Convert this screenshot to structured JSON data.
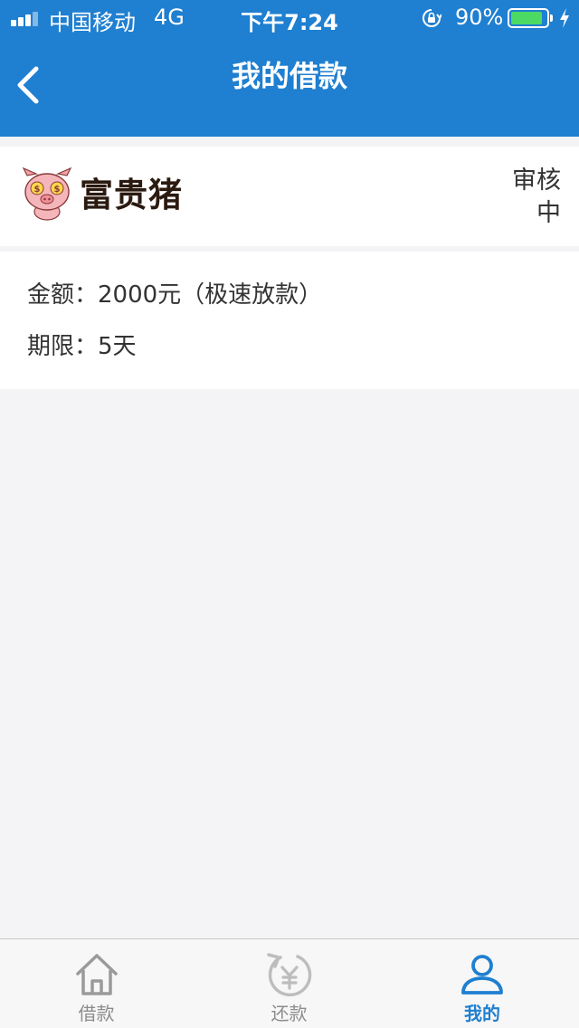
{
  "status_bar": {
    "carrier": "中国移动",
    "network": "4G",
    "time": "下午7:24",
    "battery": "90%",
    "battery_level": 0.9,
    "signal_icon": "signal-bars-icon",
    "lock_icon": "orientation-lock-icon",
    "charge_icon": "charging-bolt-icon"
  },
  "nav": {
    "title": "我的借款",
    "back_icon": "chevron-left-icon"
  },
  "loan": {
    "brand": "富贵猪",
    "brand_logo": "pig-logo-icon",
    "status": "审核中",
    "amount": "金额：2000元（极速放款）",
    "term": "期限：5天"
  },
  "tabs": [
    {
      "label": "借款",
      "icon": "home-icon",
      "active": false
    },
    {
      "label": "还款",
      "icon": "repay-yen-icon",
      "active": false
    },
    {
      "label": "我的",
      "icon": "user-icon",
      "active": true
    }
  ],
  "colors": {
    "nav_background": "#1f7fd0",
    "accent": "#1f7fd0",
    "page_background": "#f4f4f6",
    "battery_fill": "#4cd964",
    "inactive_tab": "#8c8c8c"
  }
}
